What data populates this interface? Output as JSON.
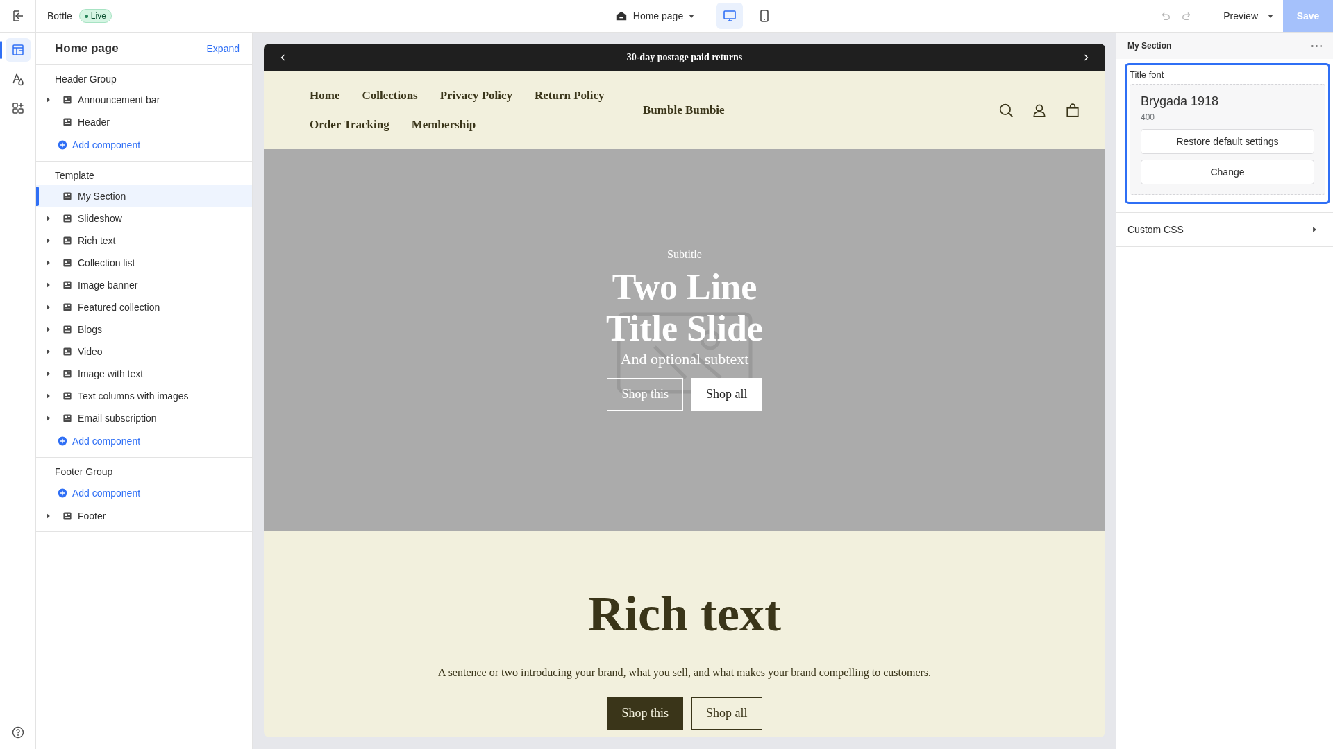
{
  "topbar": {
    "store": "Bottle",
    "status": "Live",
    "page": "Home page",
    "devices": [
      {
        "kind": "desktop",
        "selected": true
      },
      {
        "kind": "mobile",
        "selected": false
      }
    ],
    "preview": "Preview",
    "save": {
      "label": "Save",
      "disabled": true
    }
  },
  "rail": [
    {
      "kind": "sections",
      "selected": true
    },
    {
      "kind": "theme",
      "selected": false
    },
    {
      "kind": "apps",
      "selected": false
    }
  ],
  "sidebar": {
    "title": "Home page",
    "expand": "Expand",
    "groups": [
      {
        "name": "Header Group",
        "entries": [
          {
            "kind": "item",
            "label": "Announcement bar",
            "expandable": true,
            "selected": false
          },
          {
            "kind": "item",
            "label": "Header",
            "expandable": false,
            "selected": false
          },
          {
            "kind": "add",
            "label": "Add component"
          }
        ]
      },
      {
        "name": "Template",
        "entries": [
          {
            "kind": "item",
            "label": "My Section",
            "expandable": false,
            "selected": true
          },
          {
            "kind": "item",
            "label": "Slideshow",
            "expandable": true,
            "selected": false
          },
          {
            "kind": "item",
            "label": "Rich text",
            "expandable": true,
            "selected": false
          },
          {
            "kind": "item",
            "label": "Collection list",
            "expandable": true,
            "selected": false
          },
          {
            "kind": "item",
            "label": "Image banner",
            "expandable": true,
            "selected": false
          },
          {
            "kind": "item",
            "label": "Featured collection",
            "expandable": true,
            "selected": false
          },
          {
            "kind": "item",
            "label": "Blogs",
            "expandable": true,
            "selected": false
          },
          {
            "kind": "item",
            "label": "Video",
            "expandable": true,
            "selected": false
          },
          {
            "kind": "item",
            "label": "Image with text",
            "expandable": true,
            "selected": false
          },
          {
            "kind": "item",
            "label": "Text columns with images",
            "expandable": true,
            "selected": false
          },
          {
            "kind": "item",
            "label": "Email subscription",
            "expandable": true,
            "selected": false
          },
          {
            "kind": "add",
            "label": "Add component"
          }
        ]
      },
      {
        "name": "Footer Group",
        "entries": [
          {
            "kind": "add",
            "label": "Add component"
          },
          {
            "kind": "item",
            "label": "Footer",
            "expandable": true,
            "selected": false
          }
        ]
      }
    ]
  },
  "preview": {
    "announcement": "30-day postage paid returns",
    "nav": [
      "Home",
      "Collections",
      "Privacy Policy",
      "Return Policy",
      "Order Tracking",
      "Membership"
    ],
    "brand": "Bumble Bumbie",
    "hero": {
      "subtitle": "Subtitle",
      "title": "Two Line Title Slide",
      "subtext": "And optional subtext",
      "buttons": [
        {
          "label": "Shop this",
          "kind": "outline"
        },
        {
          "label": "Shop all",
          "kind": "solid"
        }
      ]
    },
    "rich_text": {
      "title": "Rich text",
      "text": "A sentence or two introducing your brand, what you sell, and what makes your brand compelling to customers.",
      "buttons": [
        {
          "label": "Shop this",
          "kind": "solid"
        },
        {
          "label": "Shop all",
          "kind": "outline"
        }
      ]
    }
  },
  "panel": {
    "title": "My Section",
    "setting": {
      "label": "Title font",
      "font": "Brygada 1918",
      "weight": "400",
      "buttons": [
        "Restore default settings",
        "Change"
      ]
    },
    "custom_css": "Custom CSS"
  }
}
